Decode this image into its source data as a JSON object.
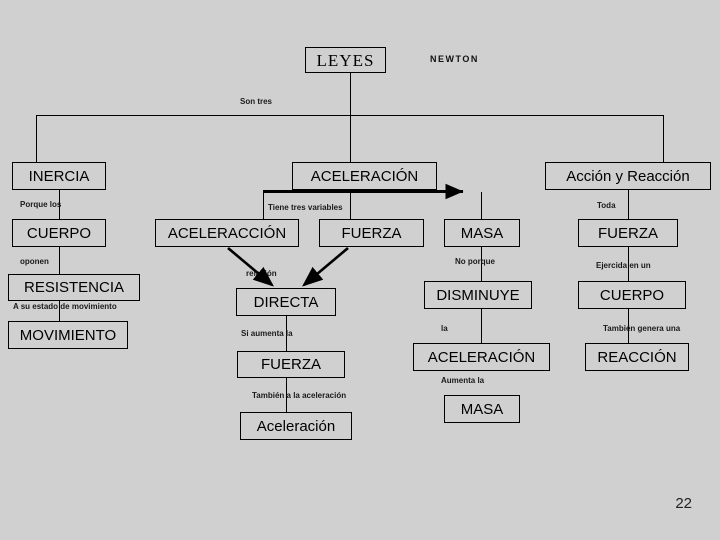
{
  "slide": {
    "page_number": "22",
    "background_color": "#d0d0d0",
    "line_color": "#000000"
  },
  "root": {
    "title": "LEYES",
    "side_note": "NEWTON",
    "branch_label": "Son tres"
  },
  "columns": [
    {
      "id": "inercia",
      "heading": "INERCIA",
      "chain": [
        {
          "connector": "Porque los",
          "node": "CUERPO"
        },
        {
          "connector": "oponen",
          "node": "RESISTENCIA"
        },
        {
          "connector": "A su estado de movimiento",
          "node": "MOVIMIENTO"
        }
      ]
    },
    {
      "id": "aceleracion",
      "heading": "ACELERACIÓN",
      "variables_label": "Tiene tres variables",
      "variables": [
        "ACELERACCIÓN",
        "FUERZA",
        "MASA"
      ],
      "relation_label": "relación",
      "relation_node": "DIRECTA",
      "chain": [
        {
          "connector": "Si aumenta la",
          "node": "FUERZA"
        },
        {
          "connector": "También a la aceleración",
          "node": "Aceleración"
        }
      ],
      "mass_chain": [
        {
          "connector": "No porque",
          "node": "DISMINUYE"
        },
        {
          "connector": "la",
          "node": "ACELERACIÓN"
        },
        {
          "connector": "Aumenta la",
          "node": "MASA"
        }
      ]
    },
    {
      "id": "accion-reaccion",
      "heading": "Acción y Reacción",
      "chain": [
        {
          "connector": "Toda",
          "node": "FUERZA"
        },
        {
          "connector": "Ejercida en un",
          "node": "CUERPO"
        },
        {
          "connector": "También genera una",
          "node": "REACCIÓN"
        }
      ]
    }
  ]
}
